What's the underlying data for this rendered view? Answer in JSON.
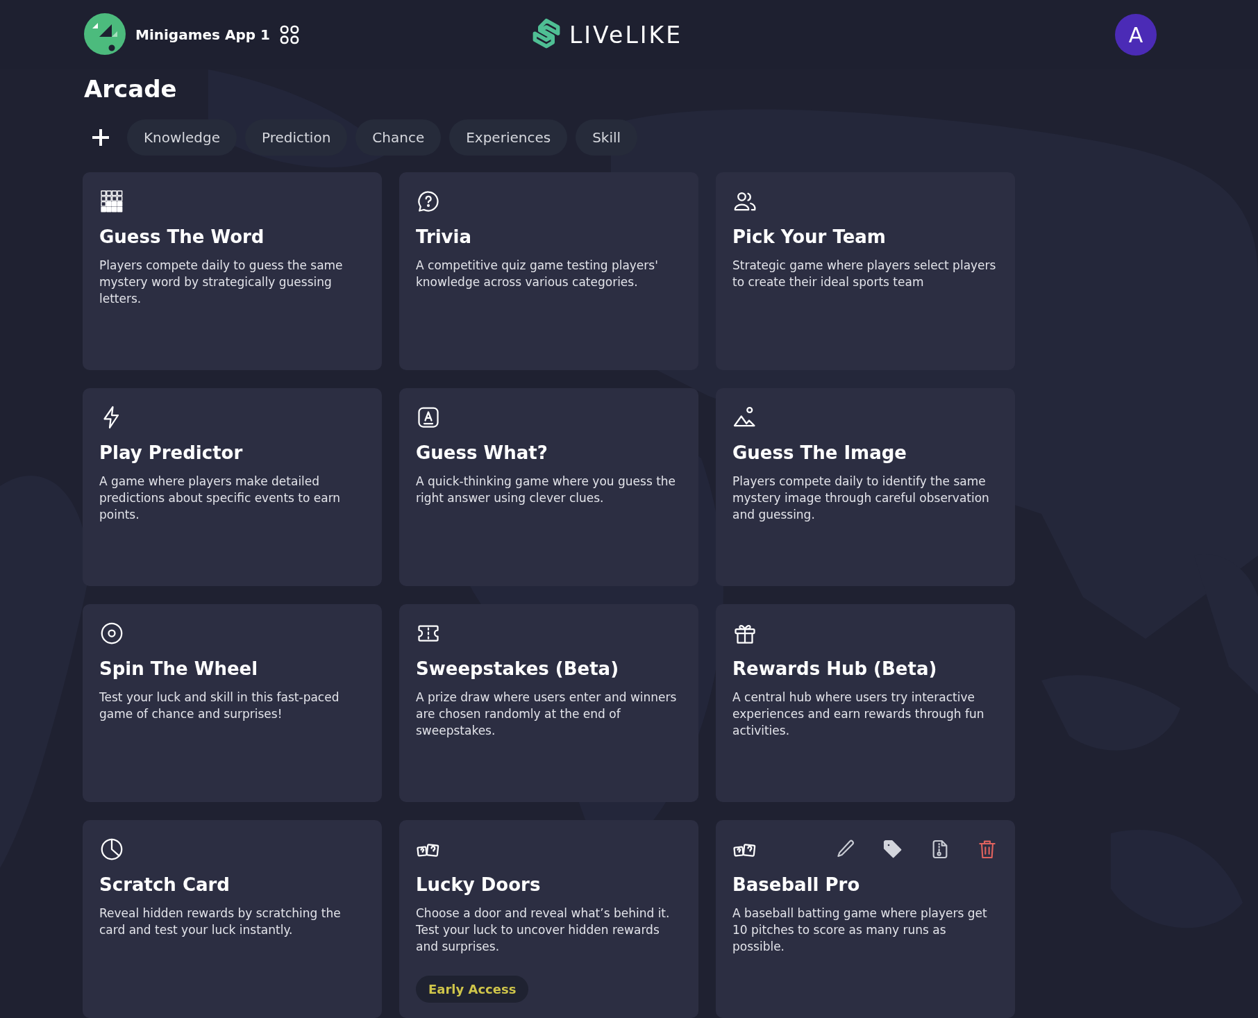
{
  "header": {
    "app_name": "Minigames App 1",
    "brand": "LIVeLIKE",
    "avatar": "A"
  },
  "page": {
    "title": "Arcade"
  },
  "filters": [
    {
      "label": "Knowledge"
    },
    {
      "label": "Prediction"
    },
    {
      "label": "Chance"
    },
    {
      "label": "Experiences"
    },
    {
      "label": "Skill"
    }
  ],
  "games": [
    {
      "title": "Guess The Word",
      "description": "Players compete daily to guess the same mystery word by strategically guessing letters.",
      "hovered": false
    },
    {
      "title": "Trivia",
      "description": "A competitive quiz game testing players' knowledge across various categories.",
      "hovered": false
    },
    {
      "title": "Pick Your Team",
      "description": "Strategic game where players select players to create their ideal sports team",
      "hovered": false
    },
    {
      "title": "Play Predictor",
      "description": "A game where players make detailed predictions about specific events to earn points.",
      "hovered": false
    },
    {
      "title": "Guess What?",
      "description": "A quick-thinking game where you guess the right answer using clever clues.",
      "hovered": false
    },
    {
      "title": "Guess The Image",
      "description": "Players compete daily to identify the same mystery image through careful observation and guessing.",
      "hovered": false
    },
    {
      "title": "Spin The Wheel",
      "description": "Test your luck and skill in this fast-paced game of chance and surprises!",
      "hovered": false
    },
    {
      "title": "Sweepstakes (Beta)",
      "description": "A prize draw where users enter and winners are chosen randomly at the end of sweepstakes.",
      "hovered": false
    },
    {
      "title": "Rewards Hub (Beta)",
      "description": "A central hub where users try interactive experiences and earn rewards through fun activities.",
      "hovered": false
    },
    {
      "title": "Scratch Card",
      "description": "Reveal hidden rewards by scratching the card and test your luck instantly.",
      "hovered": false
    },
    {
      "title": "Lucky Doors",
      "description": "Choose a door and reveal what’s behind it. Test your luck to uncover hidden rewards and surprises.",
      "badge": "Early Access",
      "hovered": false
    },
    {
      "title": "Baseball Pro",
      "description": "A baseball batting game where players get 10 pitches to score as many runs as possible.",
      "hovered": true
    }
  ]
}
